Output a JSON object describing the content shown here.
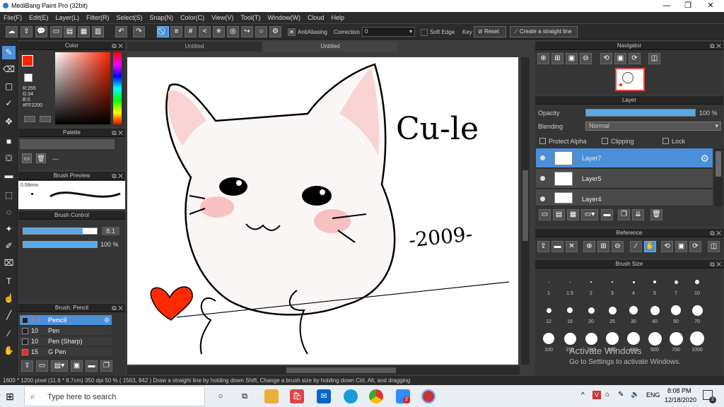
{
  "window": {
    "title": "MediBang Paint Pro (32bit)"
  },
  "menu": [
    "File(F)",
    "Edit(E)",
    "Layer(L)",
    "Filter(R)",
    "Select(S)",
    "Snap(N)",
    "Color(C)",
    "View(V)",
    "Tool(T)",
    "Window(W)",
    "Cloud",
    "Help"
  ],
  "toolbar": {
    "antialiasing": "AntiAliasing",
    "correction_label": "Correction",
    "correction_value": "0",
    "soft_edge": "Soft Edge",
    "key": "Key",
    "reset": "Reset",
    "straight_line": "Create a straight line"
  },
  "panels": {
    "color": "Color",
    "palette": "Palette",
    "brush_preview": "Brush Preview",
    "brush_control": "Brush Control",
    "brush": "Brush: Pencil",
    "navigator": "Navigator",
    "layer": "Layer",
    "reference": "Reference",
    "brush_size": "Brush Size"
  },
  "color": {
    "r": "R:255",
    "g": "G:34",
    "b": "B:0",
    "hex": "#FF2200",
    "fg": "#ff2200"
  },
  "palette": {
    "text": "---"
  },
  "brush_preview": {
    "size": "0.59mm"
  },
  "brush_control": {
    "size": "8.1",
    "opacity": "100 %",
    "size_fill": 0.81,
    "opacity_fill": 1.0
  },
  "brushes": [
    {
      "size": "8.1",
      "name": "Pencil",
      "color": "#222222",
      "selected": true
    },
    {
      "size": "10",
      "name": "Pen",
      "color": "#222222",
      "selected": false
    },
    {
      "size": "10",
      "name": "Pen (Sharp)",
      "color": "#222222",
      "selected": false
    },
    {
      "size": "15",
      "name": "G Pen",
      "color": "#ff2222",
      "selected": false
    }
  ],
  "tabs": [
    "Untitled",
    "Untitled"
  ],
  "canvas_text": {
    "cute": "Cu-le",
    "year": "-2009-"
  },
  "layer": {
    "opacity_label": "Opacity",
    "opacity_value": "100 %",
    "blending_label": "Blending",
    "blending_value": "Normal",
    "protect_alpha": "Protect Alpha",
    "clipping": "Clipping",
    "lock": "Lock",
    "items": [
      "Layer7",
      "Layer5",
      "Layer4"
    ]
  },
  "brush_sizes": [
    "1",
    "1.5",
    "2",
    "3",
    "4",
    "5",
    "7",
    "10",
    "12",
    "15",
    "20",
    "25",
    "30",
    "40",
    "50",
    "70",
    "100",
    "150",
    "200",
    "300",
    "400",
    "500",
    "700",
    "1000"
  ],
  "watermark": {
    "line1": "Activate Windows",
    "line2": "Go to Settings to activate Windows."
  },
  "status": "1600 * 1200 pixel   (11.6 * 8.7cm)   350 dpi   50 %   ( 1563, 842 )   Draw a straight line by holding down Shift, Change a brush size by holding down Ctrl, Alt, and dragging",
  "taskbar": {
    "search": "Type here to search",
    "lang": "ENG",
    "time": "8:08 PM",
    "date": "12/18/2020",
    "notif": "2"
  }
}
